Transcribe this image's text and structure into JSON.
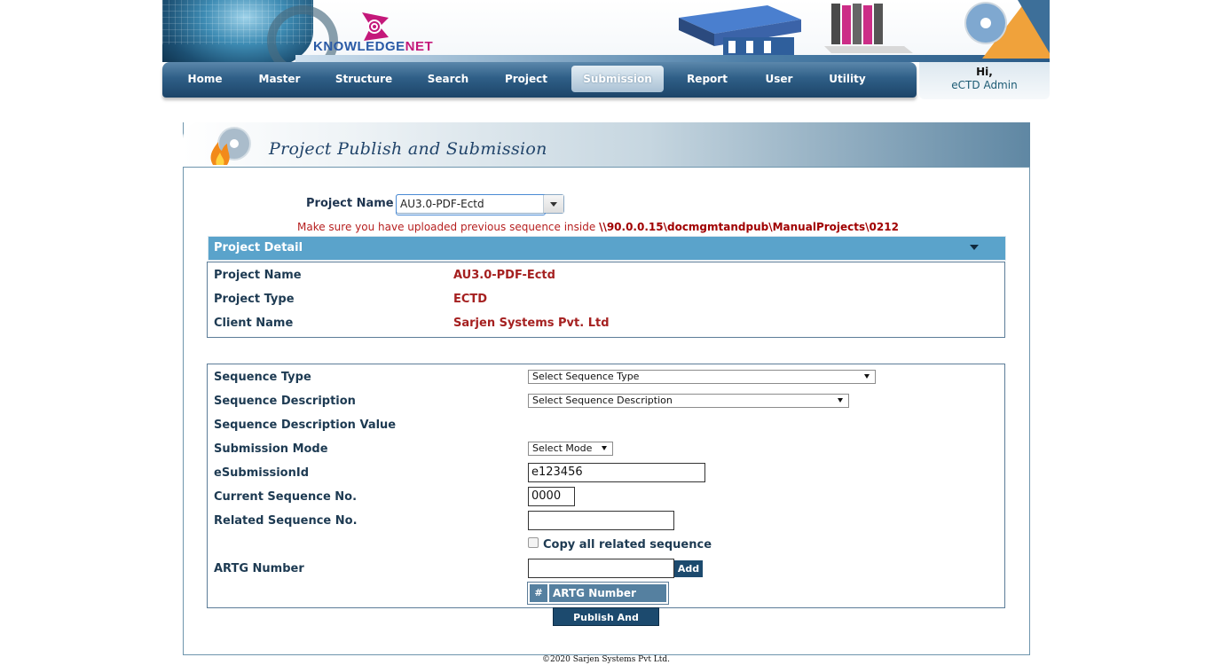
{
  "brand": {
    "name_part1": "KNOWLEDGE",
    "name_part2": "NET"
  },
  "nav": {
    "items": [
      {
        "label": "Home"
      },
      {
        "label": "Master"
      },
      {
        "label": "Structure"
      },
      {
        "label": "Search"
      },
      {
        "label": "Project"
      },
      {
        "label": "Submission"
      },
      {
        "label": "Report"
      },
      {
        "label": "User"
      },
      {
        "label": "Utility"
      }
    ],
    "active": "Submission"
  },
  "user": {
    "greeting": "Hi,",
    "name": "eCTD Admin"
  },
  "page": {
    "title": "Project Publish and Submission"
  },
  "project_select": {
    "label": "Project Name",
    "value": "AU3.0-PDF-Ectd"
  },
  "warning": {
    "text": "Make sure you have uploaded previous sequence inside ",
    "path": "\\\\90.0.0.15\\docmgmtandpub\\ManualProjects\\0212"
  },
  "detail": {
    "title": "Project Detail",
    "rows": [
      {
        "label": "Project Name",
        "value": "AU3.0-PDF-Ectd"
      },
      {
        "label": "Project Type",
        "value": "ECTD"
      },
      {
        "label": "Client Name",
        "value": "Sarjen Systems Pvt. Ltd"
      }
    ]
  },
  "form": {
    "sequence_type": {
      "label": "Sequence Type",
      "value": "Select Sequence Type"
    },
    "sequence_description": {
      "label": "Sequence Description",
      "value": "Select Sequence Description"
    },
    "sequence_description_value": {
      "label": "Sequence Description Value"
    },
    "submission_mode": {
      "label": "Submission Mode",
      "value": "Select Mode"
    },
    "esubmission_id": {
      "label": "eSubmissionId",
      "value": "e123456"
    },
    "current_sequence": {
      "label": "Current Sequence No.",
      "value": "0000"
    },
    "related_sequence": {
      "label": "Related Sequence No.",
      "value": ""
    },
    "copy_related": {
      "label": "Copy all related sequence",
      "checked": false
    },
    "artg_number": {
      "label": "ARTG Number",
      "value": "",
      "add_label": "Add"
    },
    "artg_grid": {
      "hash": "#",
      "column": "ARTG Number"
    },
    "submit_label": "Publish And Submit"
  },
  "footer": {
    "text": "©2020 Sarjen Systems Pvt Ltd."
  },
  "colors": {
    "nav_dark": "#1c4468",
    "label": "#1d3a52",
    "value_red": "#a52020",
    "detail_bar": "#5aa3cb",
    "button": "#1c4a6e"
  }
}
